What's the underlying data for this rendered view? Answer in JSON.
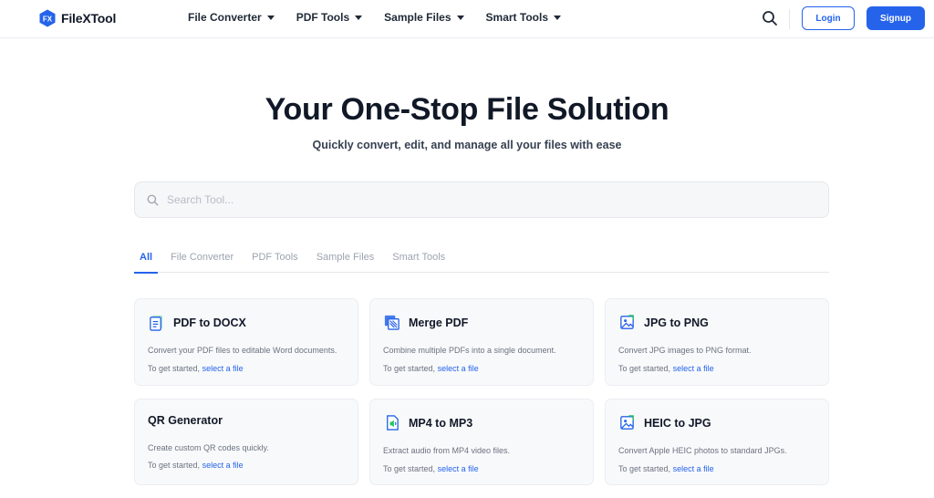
{
  "brand": {
    "name": "FileXTool",
    "logo_text": "FX"
  },
  "nav": [
    {
      "label": "File Converter"
    },
    {
      "label": "PDF Tools"
    },
    {
      "label": "Sample Files"
    },
    {
      "label": "Smart Tools"
    }
  ],
  "auth": {
    "login": "Login",
    "signup": "Signup"
  },
  "hero": {
    "title": "Your One-Stop File Solution",
    "subtitle": "Quickly convert, edit, and manage all your files with ease"
  },
  "search": {
    "placeholder": "Search Tool..."
  },
  "tabs": [
    "All",
    "File Converter",
    "PDF Tools",
    "Sample Files",
    "Smart Tools"
  ],
  "active_tab": "All",
  "colors": {
    "accent": "#2563eb",
    "text": "#111827",
    "muted": "#6b7280"
  },
  "cards": [
    {
      "title": "PDF to DOCX",
      "icon": "docx-file-icon",
      "desc": "Convert your PDF files to editable Word documents.",
      "start": "To get started,",
      "link": "select a file"
    },
    {
      "title": "Merge PDF",
      "icon": "merge-pdf-icon",
      "desc": "Combine multiple PDFs into a single document.",
      "start": "To get started,",
      "link": "select a file"
    },
    {
      "title": "JPG to PNG",
      "icon": "image-convert-icon",
      "desc": "Convert JPG images to PNG format.",
      "start": "To get started,",
      "link": "select a file"
    },
    {
      "title": "QR Generator",
      "icon": "",
      "desc": "Create custom QR codes quickly.",
      "start": "To get started,",
      "link": "select a file"
    },
    {
      "title": "MP4 to MP3",
      "icon": "audio-file-icon",
      "desc": "Extract audio from MP4 video files.",
      "start": "To get started,",
      "link": "select a file"
    },
    {
      "title": "HEIC to JPG",
      "icon": "image-convert-icon",
      "desc": "Convert Apple HEIC photos to standard JPGs.",
      "start": "To get started,",
      "link": "select a file"
    }
  ]
}
